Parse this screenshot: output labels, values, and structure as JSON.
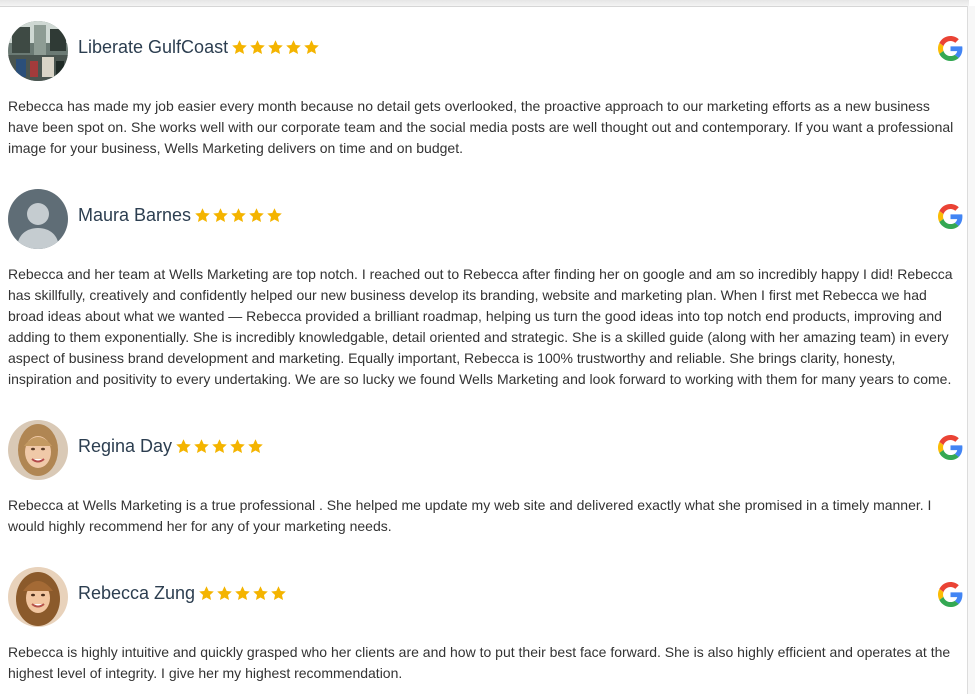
{
  "reviews": [
    {
      "name": "Liberate GulfCoast",
      "rating": 5,
      "source_icon": "google-g-icon",
      "avatar": "photo-storefront",
      "text": "Rebecca has made my job easier every month because no detail gets overlooked, the proactive approach to our marketing efforts as a new business have been spot on. She works well with our corporate team and the social media posts are well thought out and contemporary. If you want a professional image for your business, Wells Marketing delivers on time and on budget."
    },
    {
      "name": "Maura Barnes",
      "rating": 5,
      "source_icon": "google-g-icon",
      "avatar": "default-user",
      "text": "Rebecca and her team at Wells Marketing are top notch. I reached out to Rebecca after finding her on google and am so incredibly happy I did! Rebecca has skillfully, creatively and confidently helped our new business develop its branding, website and marketing plan. When I first met Rebecca we had broad ideas about what we wanted — Rebecca provided a brilliant roadmap, helping us turn the good ideas into top notch end products, improving and adding to them exponentially. She is incredibly knowledgable, detail oriented and strategic. She is a skilled guide (along with her amazing team) in every aspect of business brand development and marketing. Equally important, Rebecca is 100% trustworthy and reliable. She brings clarity, honesty, inspiration and positivity to every undertaking. We are so lucky we found Wells Marketing and look forward to working with them for many years to come."
    },
    {
      "name": "Regina Day",
      "rating": 5,
      "source_icon": "google-g-icon",
      "avatar": "photo-woman-blonde",
      "text": "Rebecca at Wells Marketing is a true professional . She helped me update my web site and delivered exactly what she promised in a timely manner. I would highly recommend her for any of your marketing needs."
    },
    {
      "name": "Rebecca Zung",
      "rating": 5,
      "source_icon": "google-g-icon",
      "avatar": "photo-woman-brunette",
      "text": "Rebecca is highly intuitive and quickly grasped who her clients are and how to put their best face forward. She is also highly efficient and operates at the highest level of integrity. I give her my highest recommendation."
    }
  ],
  "colors": {
    "star": "#f4b400",
    "name": "#2c3e50",
    "text": "#333333"
  }
}
